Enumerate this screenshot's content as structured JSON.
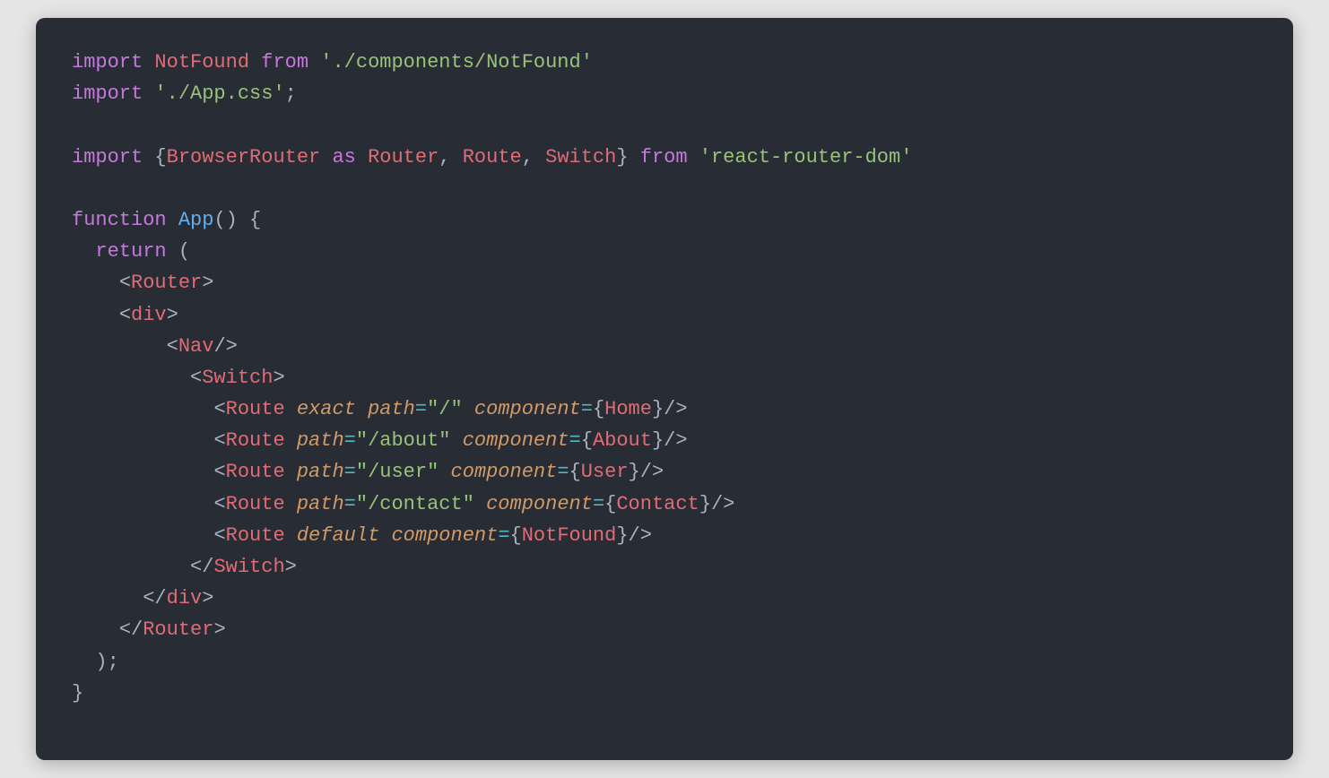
{
  "code": {
    "line1": {
      "import": "import",
      "notfound": "NotFound",
      "from": "from",
      "path": "'./components/NotFound'"
    },
    "line2": {
      "import": "import",
      "path": "'./App.css'",
      "semi": ";"
    },
    "line3": {
      "import": "import",
      "lbrace": "{",
      "browserrouter": "BrowserRouter",
      "as": "as",
      "router": "Router",
      "comma1": ",",
      "route": "Route",
      "comma2": ",",
      "switch": "Switch",
      "rbrace": "}",
      "from": "from",
      "path": "'react-router-dom'"
    },
    "line4": {
      "function": "function",
      "app": "App",
      "parens": "()",
      "lbrace": "{"
    },
    "line5": {
      "return": "return",
      "lparen": "("
    },
    "line6": {
      "lt": "<",
      "router": "Router",
      "gt": ">"
    },
    "line7": {
      "lt": "<",
      "div": "div",
      "gt": ">"
    },
    "line8": {
      "lt": "<",
      "nav": "Nav",
      "close": "/>"
    },
    "line9": {
      "lt": "<",
      "switch": "Switch",
      "gt": ">"
    },
    "line10": {
      "lt": "<",
      "route": "Route",
      "exact": "exact",
      "path": "path",
      "eq1": "=",
      "pathval": "\"/\"",
      "component": "component",
      "eq2": "=",
      "lbrace": "{",
      "home": "Home",
      "rbrace": "}",
      "close": "/>"
    },
    "line11": {
      "lt": "<",
      "route": "Route",
      "path": "path",
      "eq1": "=",
      "pathval": "\"/about\"",
      "component": "component",
      "eq2": "=",
      "lbrace": "{",
      "about": "About",
      "rbrace": "}",
      "close": "/>"
    },
    "line12": {
      "lt": "<",
      "route": "Route",
      "path": "path",
      "eq1": "=",
      "pathval": "\"/user\"",
      "component": "component",
      "eq2": "=",
      "lbrace": "{",
      "user": "User",
      "rbrace": "}",
      "close": "/>"
    },
    "line13": {
      "lt": "<",
      "route": "Route",
      "path": "path",
      "eq1": "=",
      "pathval": "\"/contact\"",
      "component": "component",
      "eq2": "=",
      "lbrace": "{",
      "contact": "Contact",
      "rbrace": "}",
      "close": "/>"
    },
    "line14": {
      "lt": "<",
      "route": "Route",
      "default": "default",
      "component": "component",
      "eq": "=",
      "lbrace": "{",
      "notfound": "NotFound",
      "rbrace": "}",
      "close": "/>"
    },
    "line15": {
      "lt": "</",
      "switch": "Switch",
      "gt": ">"
    },
    "line16": {
      "lt": "</",
      "div": "div",
      "gt": ">"
    },
    "line17": {
      "lt": "</",
      "router": "Router",
      "gt": ">"
    },
    "line18": {
      "rparen": ")",
      "semi": ";"
    },
    "line19": {
      "rbrace": "}"
    }
  }
}
